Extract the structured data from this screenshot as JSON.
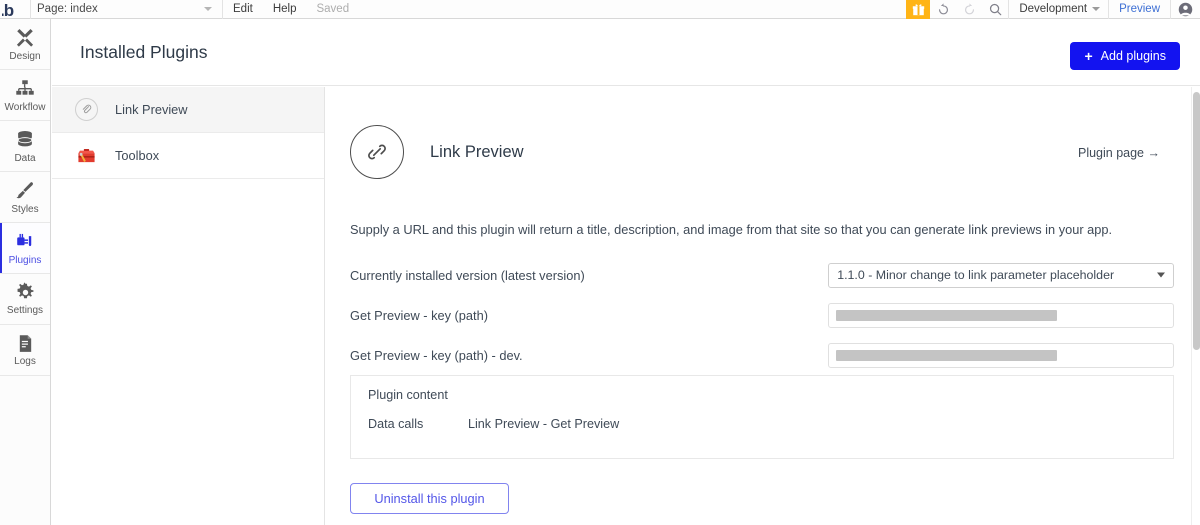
{
  "topbar": {
    "logo_icon": "bubble-logo-icon",
    "page_label": "Page: index",
    "page_caret_icon": "chevron-down-icon",
    "edit_label": "Edit",
    "help_label": "Help",
    "saved_label": "Saved",
    "gift_icon": "gift-icon",
    "undo_icon": "undo-icon",
    "redo_icon": "redo-icon",
    "search_icon": "search-icon",
    "env_label": "Development",
    "env_caret_icon": "chevron-down-icon",
    "preview_label": "Preview",
    "avatar_icon": "user-avatar-icon",
    "gift_color": "#ffb416",
    "preview_color": "#3d6fd4"
  },
  "rail": {
    "items": [
      {
        "label": "Design",
        "icon": "design-tools-icon",
        "active": false
      },
      {
        "label": "Workflow",
        "icon": "workflow-tree-icon",
        "active": false
      },
      {
        "label": "Data",
        "icon": "database-icon",
        "active": false
      },
      {
        "label": "Styles",
        "icon": "paintbrush-icon",
        "active": false
      },
      {
        "label": "Plugins",
        "icon": "plug-icon",
        "active": true
      },
      {
        "label": "Settings",
        "icon": "gear-icon",
        "active": false
      },
      {
        "label": "Logs",
        "icon": "document-icon",
        "active": false
      }
    ],
    "active_color": "#4c4fe3"
  },
  "header": {
    "title": "Installed Plugins",
    "add_plugins_label": "Add plugins",
    "add_plugins_plus": "+",
    "add_plugins_color": "#1313f0"
  },
  "plugin_list": {
    "items": [
      {
        "name": "Link Preview",
        "icon": "paperclip-circle-icon",
        "selected": true
      },
      {
        "name": "Toolbox",
        "icon": "toolbox-icon",
        "selected": false
      }
    ]
  },
  "detail": {
    "icon": "chain-link-circle-icon",
    "title": "Link Preview",
    "plugin_page_link": "Plugin page →",
    "description": "Supply a URL and this plugin will return a title, description, and image from that site so that you can generate link previews in your app.",
    "fields": [
      {
        "label": "Currently installed version (latest version)",
        "type": "select",
        "value": "1.1.0 - Minor change to link parameter placeholder",
        "caret_icon": "chevron-down-icon"
      },
      {
        "label": "Get Preview - key (path)",
        "type": "masked-text",
        "value": "",
        "placeholder": ""
      },
      {
        "label": "Get Preview - key (path) - dev.",
        "type": "masked-text",
        "value": "",
        "placeholder": ""
      }
    ],
    "content_box": {
      "title": "Plugin content",
      "rows": [
        {
          "key": "Data calls",
          "value": "Link Preview - Get Preview"
        }
      ]
    },
    "uninstall_label": "Uninstall this plugin",
    "uninstall_color": "#5356e8"
  }
}
